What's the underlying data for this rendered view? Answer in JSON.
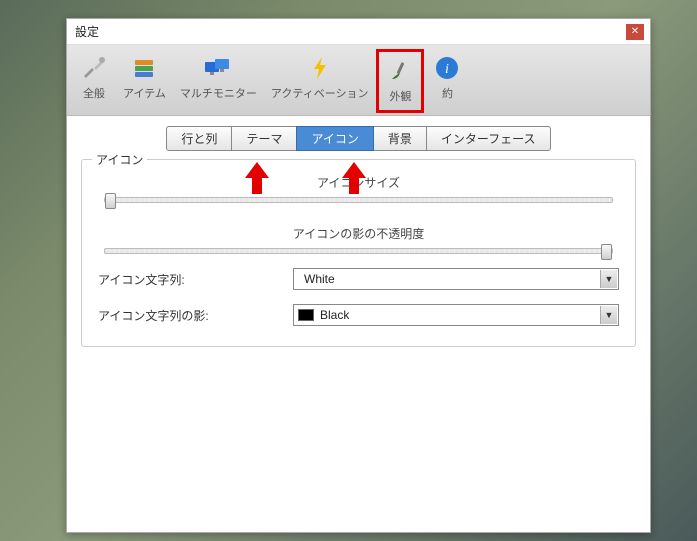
{
  "window": {
    "title": "設定"
  },
  "toolbar": {
    "items": [
      {
        "label": "全般"
      },
      {
        "label": "アイテム"
      },
      {
        "label": "マルチモニター"
      },
      {
        "label": "アクティベーション"
      },
      {
        "label": "外観"
      },
      {
        "label": "約"
      }
    ]
  },
  "tabs": {
    "items": [
      {
        "label": "行と列"
      },
      {
        "label": "テーマ"
      },
      {
        "label": "アイコン"
      },
      {
        "label": "背景"
      },
      {
        "label": "インターフェース"
      }
    ],
    "active_index": 2
  },
  "panel": {
    "legend": "アイコン",
    "icon_size_label": "アイコンサイズ",
    "shadow_opacity_label": "アイコンの影の不透明度",
    "icon_text_label": "アイコン文字列:",
    "icon_text_value": "White",
    "icon_text_swatch": "#ffffff",
    "icon_shadow_label": "アイコン文字列の影:",
    "icon_shadow_value": "Black",
    "icon_shadow_swatch": "#000000",
    "slider1_pos_pct": 0,
    "slider2_pos_pct": 100
  }
}
